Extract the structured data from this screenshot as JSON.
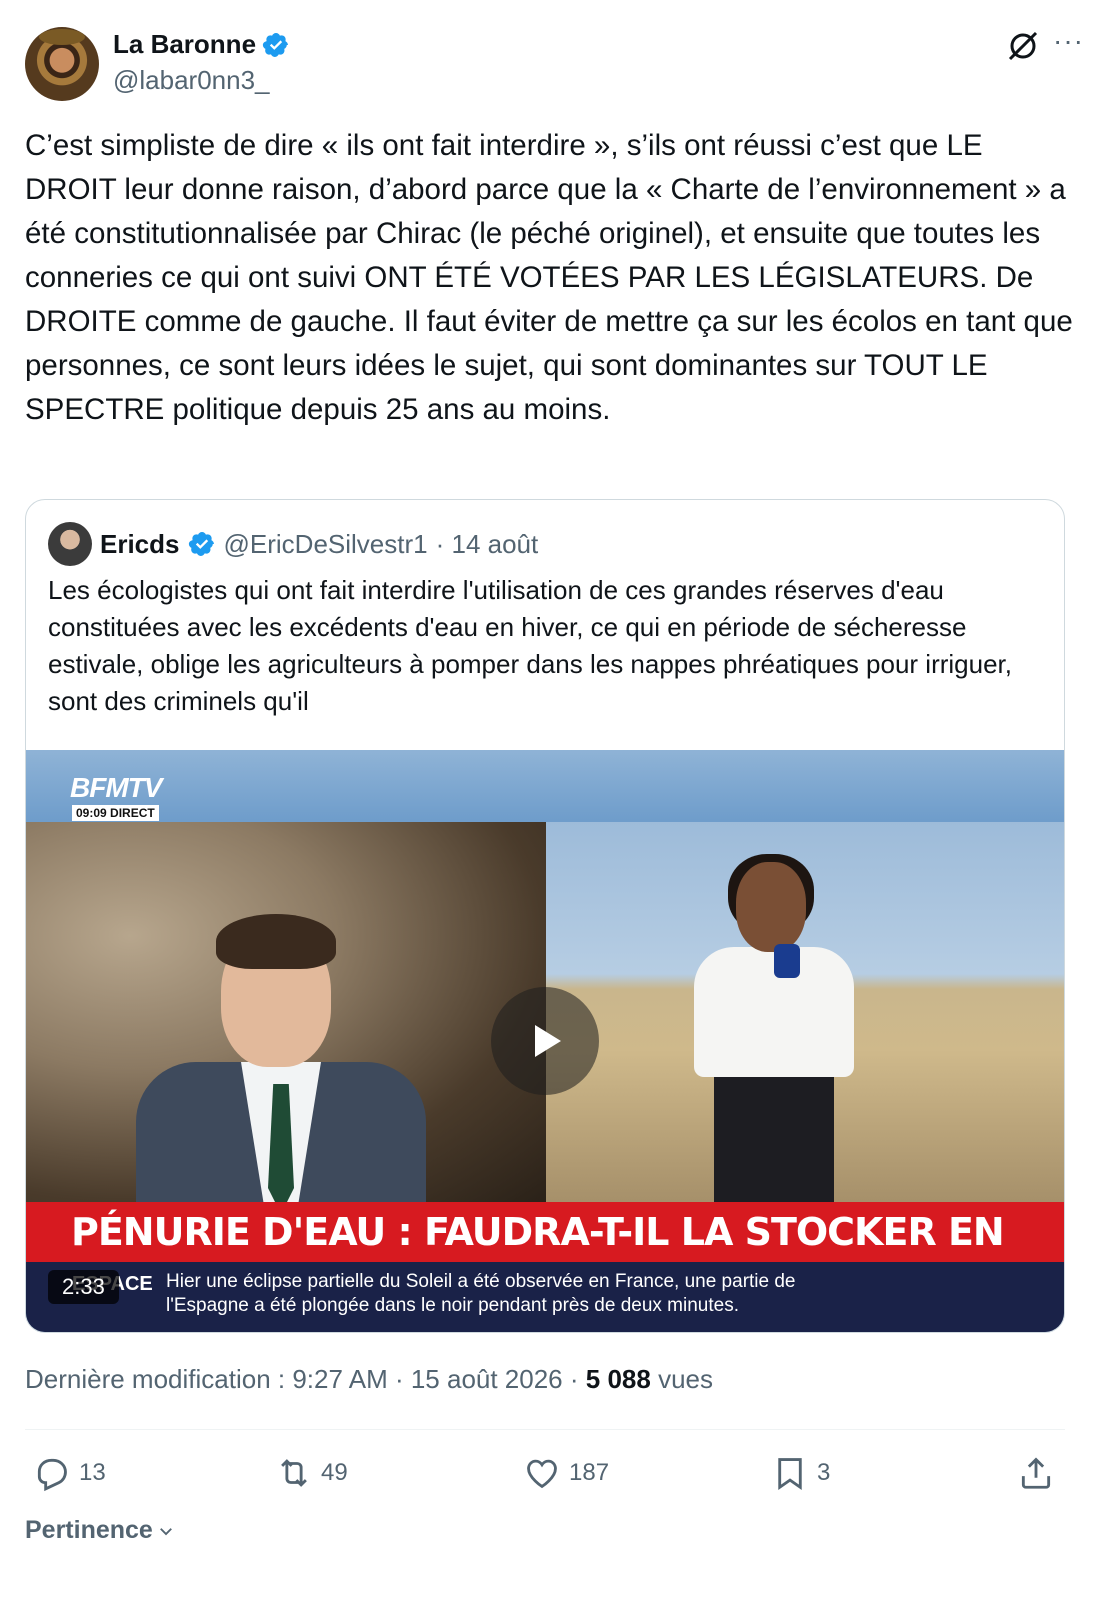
{
  "author": {
    "name": "La Baronne",
    "handle": "@labar0nn3_",
    "verified_color": "#1d9bf0"
  },
  "tweet": {
    "text": "C’est simpliste de dire « ils ont fait interdire », s’ils ont réussi c’est que LE DROIT leur donne raison, d’abord parce que la « Charte de l’environnement » a été constitutionnalisée par Chirac (le péché originel), et ensuite que toutes les conneries ce qui ont suivi ONT ÉTÉ VOTÉES PAR LES LÉGISLATEURS. De DROITE comme de gauche. Il faut éviter de mettre ça sur les écolos en tant que personnes, ce sont leurs idées le sujet, qui sont dominantes sur TOUT LE SPECTRE politique depuis 25 ans au moins."
  },
  "quote": {
    "name": "Ericds",
    "handle": "@EricDeSilvestr1",
    "date": "· 14 août",
    "text": "Les écologistes qui ont fait interdire l'utilisation de ces grandes  réserves d'eau constituées avec les excédents d'eau en hiver, ce qui en période de sécheresse estivale, oblige  les agriculteurs  à pomper dans les nappes phréatiques pour irriguer, sont des criminels qu'il",
    "video": {
      "channel": "BFMTV",
      "time_tag": "09:09  DIRECT",
      "headline": "PÉNURIE D'EAU : FAUDRA-T-IL LA STOCKER EN HIVER ?",
      "ticker_tag": "ESPACE",
      "ticker_text": "Hier une éclipse partielle du Soleil a été observée en France, une partie de l'Espagne a été plongée dans le noir pendant près de deux minutes.",
      "duration": "2:33",
      "banner_color": "#d71a20"
    }
  },
  "meta": {
    "label": "Dernière modification : 9:27 AM · 15 août 2026 · ",
    "views_count": "5 088",
    "views_label": " vues"
  },
  "actions": {
    "replies": "13",
    "reposts": "49",
    "likes": "187",
    "bookmarks": "3"
  },
  "sort": {
    "label": "Pertinence"
  }
}
